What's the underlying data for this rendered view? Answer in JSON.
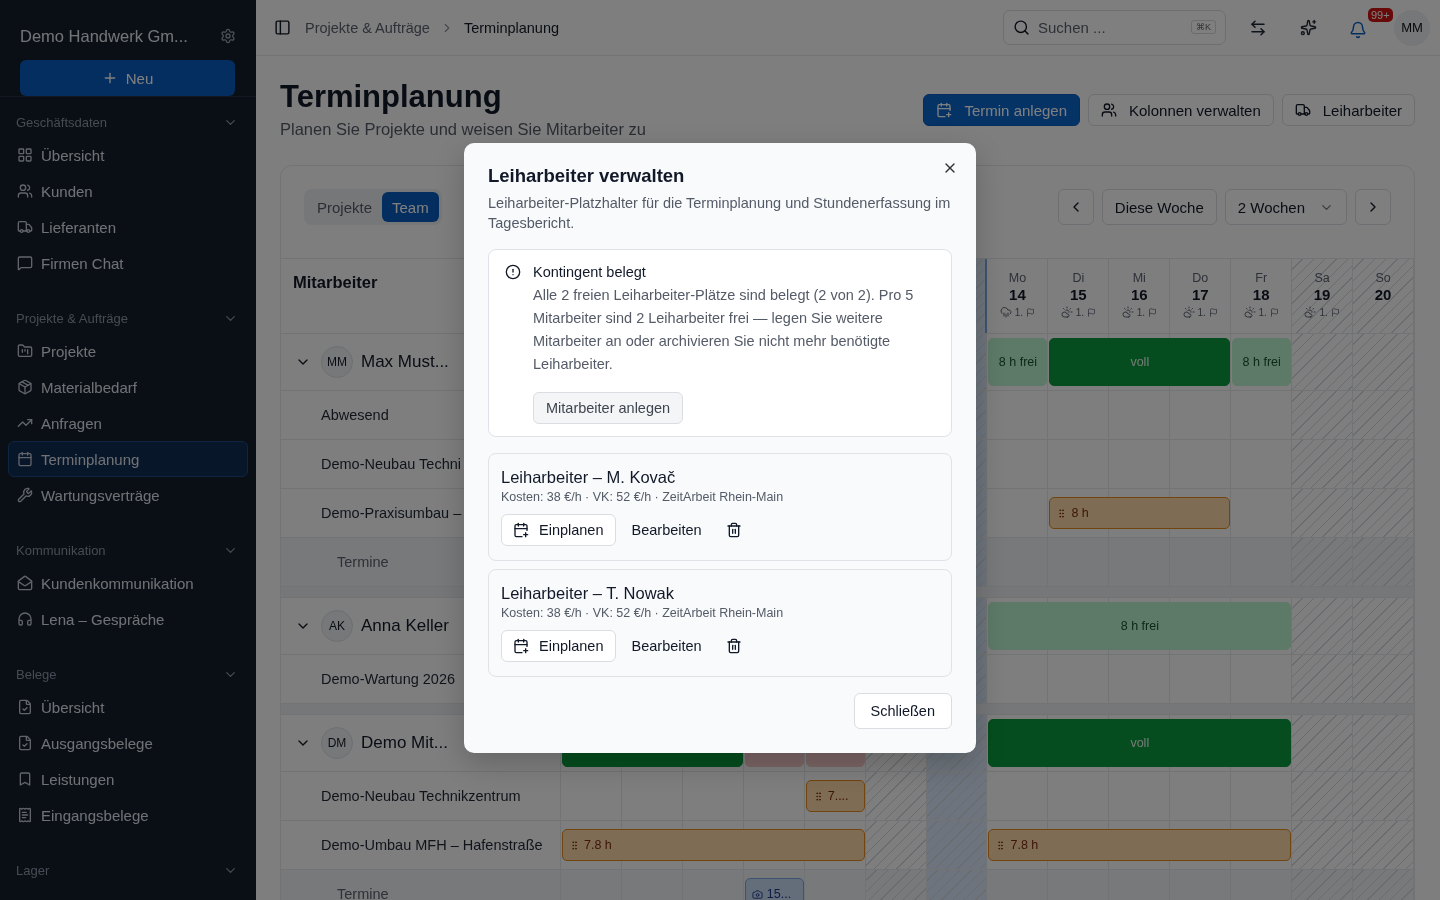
{
  "sidebar": {
    "company": "Demo Handwerk Gm...",
    "new_button": "Neu",
    "sections": [
      {
        "title": "Geschäftsdaten",
        "expanded": true,
        "items": [
          {
            "label": "Übersicht",
            "selected": false
          },
          {
            "label": "Kunden",
            "selected": false
          },
          {
            "label": "Lieferanten",
            "selected": false
          },
          {
            "label": "Firmen Chat",
            "selected": false
          }
        ]
      },
      {
        "title": "Projekte & Aufträge",
        "expanded": true,
        "items": [
          {
            "label": "Projekte",
            "selected": false
          },
          {
            "label": "Materialbedarf",
            "selected": false
          },
          {
            "label": "Anfragen",
            "selected": false
          },
          {
            "label": "Terminplanung",
            "selected": true
          },
          {
            "label": "Wartungsverträge",
            "selected": false
          }
        ]
      },
      {
        "title": "Kommunikation",
        "expanded": true,
        "items": [
          {
            "label": "Kundenkommunikation",
            "selected": false
          },
          {
            "label": "Lena – Gespräche",
            "selected": false
          }
        ]
      },
      {
        "title": "Belege",
        "expanded": true,
        "items": [
          {
            "label": "Übersicht",
            "selected": false
          },
          {
            "label": "Ausgangsbelege",
            "selected": false
          },
          {
            "label": "Leistungen",
            "selected": false
          },
          {
            "label": "Eingangsbelege",
            "selected": false
          }
        ]
      },
      {
        "title": "Lager",
        "expanded": true
      }
    ]
  },
  "topbar": {
    "breadcrumb": [
      "Projekte & Aufträge",
      "Terminplanung"
    ],
    "search": {
      "placeholder": "Suchen ...",
      "shortcut": "⌘K"
    },
    "notifications": "99+",
    "avatar": "MM"
  },
  "page": {
    "title": "Terminplanung",
    "subtitle": "Planen Sie Projekte und weisen Sie Mitarbeiter zu",
    "actions": [
      {
        "label": "Termin anlegen",
        "primary": true
      },
      {
        "label": "Kolonnen verwalten",
        "primary": false
      },
      {
        "label": "Leiharbeiter",
        "primary": false
      }
    ]
  },
  "planner": {
    "tabs": [
      {
        "label": "Projekte",
        "selected": false
      },
      {
        "label": "Team",
        "selected": true
      }
    ],
    "today_button": "Diese Woche",
    "range": "2 Wochen",
    "column_header": "Mitarbeiter",
    "days": [
      {
        "weekend": true,
        "today": false
      },
      {
        "weekend": true,
        "today": true
      },
      {
        "weekday": "Mo",
        "date": "14",
        "temp": "1.",
        "weekend": false,
        "today": false
      },
      {
        "weekday": "Di",
        "date": "15",
        "temp": "1.",
        "weekend": false,
        "today": false
      },
      {
        "weekday": "Mi",
        "date": "16",
        "temp": "1.",
        "weekend": false,
        "today": false
      },
      {
        "weekday": "Do",
        "date": "17",
        "temp": "1.",
        "weekend": false,
        "today": false
      },
      {
        "weekday": "Fr",
        "date": "18",
        "temp": "1.",
        "weekend": false,
        "today": false
      },
      {
        "weekday": "Sa",
        "date": "19",
        "temp": "1.",
        "weekend": true,
        "today": false
      },
      {
        "weekday": "So",
        "date": "20",
        "weekend": true,
        "today": false
      }
    ],
    "groups": [
      {
        "initials": "MM",
        "name": "Max Must...",
        "expanded": true,
        "cells": [
          {
            "kind": "empty"
          },
          {
            "kind": "empty"
          },
          {
            "kind": "empty"
          },
          {
            "kind": "empty"
          },
          {
            "kind": "empty"
          },
          {
            "kind": "empty"
          },
          {
            "kind": "empty"
          },
          {
            "kind": "free",
            "label": "8 h frei"
          },
          {
            "kind": "full",
            "label": "voll"
          },
          {
            "kind": "full",
            "join": true
          },
          {
            "kind": "full",
            "join": true
          },
          {
            "kind": "free",
            "label": "8 h frei"
          },
          {
            "kind": "empty"
          },
          {
            "kind": "empty"
          }
        ],
        "children": [
          {
            "kind": "project",
            "label": "Abwesend"
          },
          {
            "kind": "project",
            "label": "Demo-Neubau Techni"
          },
          {
            "kind": "project",
            "label": "Demo-Praxisumbau –",
            "cells": [
              {
                "kind": "empty"
              },
              {
                "kind": "empty"
              },
              {
                "kind": "empty"
              },
              {
                "kind": "empty"
              },
              {
                "kind": "empty"
              },
              {
                "kind": "empty"
              },
              {
                "kind": "empty"
              },
              {
                "kind": "empty"
              },
              {
                "kind": "hours",
                "label": "8 h"
              },
              {
                "kind": "hours",
                "join": true
              },
              {
                "kind": "hours",
                "join": true
              }
            ]
          },
          {
            "kind": "appointments",
            "label": "Termine"
          }
        ]
      },
      {
        "initials": "AK",
        "name": "Anna Keller",
        "expanded": true,
        "cells": [
          {
            "kind": "empty"
          },
          {
            "kind": "empty"
          },
          {
            "kind": "empty"
          },
          {
            "kind": "empty"
          },
          {
            "kind": "empty"
          },
          {
            "kind": "empty"
          },
          {
            "kind": "empty"
          },
          {
            "kind": "free",
            "label": "8 h frei"
          },
          {
            "kind": "free",
            "join": true
          },
          {
            "kind": "free",
            "join": true
          },
          {
            "kind": "free",
            "join": true
          },
          {
            "kind": "free",
            "join": true
          }
        ],
        "children": [
          {
            "kind": "project",
            "label": "Demo-Wartung 2026"
          }
        ]
      },
      {
        "initials": "DM",
        "name": "Demo Mit...",
        "expanded": true,
        "cells": [
          {
            "kind": "full"
          },
          {
            "kind": "full",
            "join": true
          },
          {
            "kind": "full",
            "join": true
          },
          {
            "kind": "absence"
          },
          {
            "kind": "absence"
          },
          {
            "kind": "empty"
          },
          {
            "kind": "empty"
          },
          {
            "kind": "full",
            "label": "voll"
          },
          {
            "kind": "full",
            "join": true
          },
          {
            "kind": "full",
            "join": true
          },
          {
            "kind": "full",
            "join": true
          },
          {
            "kind": "full",
            "join": true
          }
        ],
        "children": [
          {
            "kind": "project",
            "label": "Demo-Neubau Technikzentrum",
            "cells": [
              {
                "kind": "empty"
              },
              {
                "kind": "empty"
              },
              {
                "kind": "empty"
              },
              {
                "kind": "empty"
              },
              {
                "kind": "hours",
                "label": "7...."
              }
            ]
          },
          {
            "kind": "project",
            "label": "Demo-Umbau MFH – Hafenstraße",
            "cells": [
              {
                "kind": "hours",
                "label": "7.8 h"
              },
              {
                "kind": "hours",
                "join": true
              },
              {
                "kind": "hours",
                "join": true
              },
              {
                "kind": "hours",
                "join": true
              },
              {
                "kind": "hours",
                "join": true
              },
              {
                "kind": "empty"
              },
              {
                "kind": "empty"
              },
              {
                "kind": "hours",
                "label": "7.8 h"
              },
              {
                "kind": "hours",
                "join": true
              },
              {
                "kind": "hours",
                "join": true
              },
              {
                "kind": "hours",
                "join": true
              },
              {
                "kind": "hours",
                "join": true
              }
            ]
          },
          {
            "kind": "appointments",
            "label": "Termine",
            "cells": [
              {
                "kind": "empty"
              },
              {
                "kind": "empty"
              },
              {
                "kind": "empty"
              },
              {
                "kind": "appointment",
                "label": "15..."
              }
            ]
          }
        ]
      }
    ]
  },
  "dialog": {
    "title": "Leiharbeiter verwalten",
    "description": "Leiharbeiter-Platzhalter für die Terminplanung und Stundenerfassung im Tagesbericht.",
    "alert": {
      "title": "Kontingent belegt",
      "text": "Alle 2 freien Leiharbeiter-Plätze sind belegt (2 von 2). Pro 5 Mitarbeiter sind 2 Leiharbeiter frei — legen Sie weitere Mitarbeiter an oder archivieren Sie nicht mehr benötigte Leiharbeiter.",
      "button": "Mitarbeiter anlegen"
    },
    "workers": [
      {
        "name": "Leiharbeiter – M. Kovač",
        "meta": "Kosten: 38 €/h · VK: 52 €/h · ZeitArbeit Rhein-Main",
        "plan": "Einplanen",
        "edit": "Bearbeiten"
      },
      {
        "name": "Leiharbeiter – T. Nowak",
        "meta": "Kosten: 38 €/h · VK: 52 €/h · ZeitArbeit Rhein-Main",
        "plan": "Einplanen",
        "edit": "Bearbeiten"
      }
    ],
    "close_button": "Schließen"
  }
}
